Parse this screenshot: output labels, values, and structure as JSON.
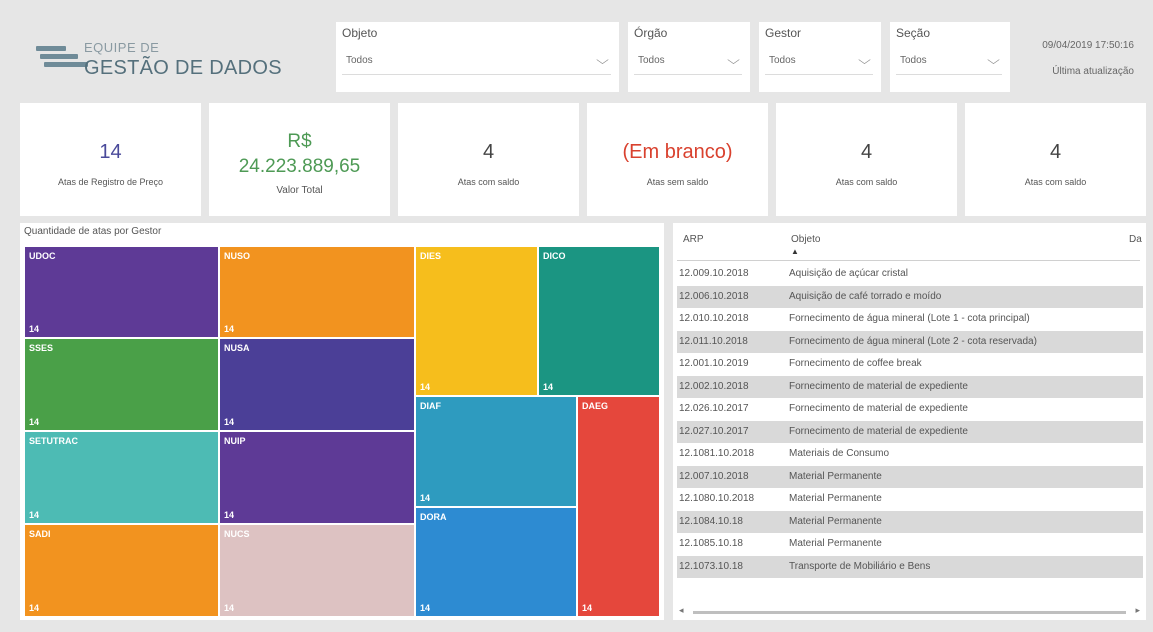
{
  "logo": {
    "small": "EQUIPE DE",
    "big": "GESTÃO DE DADOS"
  },
  "slicers": [
    {
      "title": "Objeto",
      "value": "Todos"
    },
    {
      "title": "Órgão",
      "value": "Todos"
    },
    {
      "title": "Gestor",
      "value": "Todos"
    },
    {
      "title": "Seção",
      "value": "Todos"
    }
  ],
  "status": {
    "datetime": "09/04/2019 17:50:16",
    "label": "Última atualização"
  },
  "kpis": {
    "atas": {
      "value": "14",
      "label": "Atas de Registro de Preço"
    },
    "total": {
      "currency": "R$",
      "value": "24.223.889,65",
      "label": "Valor Total"
    },
    "com_saldo_1": {
      "value": "4",
      "label": "Atas com saldo"
    },
    "sem_saldo": {
      "value": "(Em branco)",
      "label": "Atas sem saldo"
    },
    "com_saldo_2": {
      "value": "4",
      "label": "Atas com saldo"
    },
    "com_saldo_3": {
      "value": "4",
      "label": "Atas com saldo"
    }
  },
  "treemap": {
    "title": "Quantidade de atas por Gestor",
    "tiles": [
      {
        "name": "UDOC",
        "count": "14",
        "color": "#5e3a96"
      },
      {
        "name": "NUSO",
        "count": "14",
        "color": "#f2931f"
      },
      {
        "name": "SSES",
        "count": "14",
        "color": "#4aa048"
      },
      {
        "name": "NUSA",
        "count": "14",
        "color": "#4b3f97"
      },
      {
        "name": "SETUTRAC",
        "count": "14",
        "color": "#4dbbb4"
      },
      {
        "name": "NUIP",
        "count": "14",
        "color": "#5e3a96"
      },
      {
        "name": "SADI",
        "count": "14",
        "color": "#f2931f"
      },
      {
        "name": "NUCS",
        "count": "14",
        "color": "#ddc2c2"
      },
      {
        "name": "DIES",
        "count": "14",
        "color": "#f6be1c"
      },
      {
        "name": "DICO",
        "count": "14",
        "color": "#1b9582"
      },
      {
        "name": "DIAF",
        "count": "14",
        "color": "#2e9bbf"
      },
      {
        "name": "DAEG",
        "count": "14",
        "color": "#e5473c"
      },
      {
        "name": "DORA",
        "count": "14",
        "color": "#2d8bd2"
      }
    ]
  },
  "table": {
    "headers": {
      "arp": "ARP",
      "objeto": "Objeto",
      "extra": "Da"
    },
    "rows": [
      {
        "arp": "12.009.10.2018",
        "objeto": "Aquisição de açúcar cristal"
      },
      {
        "arp": "12.006.10.2018",
        "objeto": "Aquisição de café torrado e moído"
      },
      {
        "arp": "12.010.10.2018",
        "objeto": "Fornecimento de água mineral (Lote 1 - cota principal)"
      },
      {
        "arp": "12.011.10.2018",
        "objeto": "Fornecimento de água mineral (Lote 2 - cota reservada)"
      },
      {
        "arp": "12.001.10.2019",
        "objeto": "Fornecimento de coffee break"
      },
      {
        "arp": "12.002.10.2018",
        "objeto": "Fornecimento de material de expediente"
      },
      {
        "arp": "12.026.10.2017",
        "objeto": "Fornecimento de material de expediente"
      },
      {
        "arp": "12.027.10.2017",
        "objeto": "Fornecimento de material de expediente"
      },
      {
        "arp": "12.1081.10.2018",
        "objeto": "Materiais de Consumo"
      },
      {
        "arp": "12.007.10.2018",
        "objeto": "Material Permanente"
      },
      {
        "arp": "12.1080.10.2018",
        "objeto": "Material Permanente"
      },
      {
        "arp": "12.1084.10.18",
        "objeto": "Material Permanente"
      },
      {
        "arp": "12.1085.10.18",
        "objeto": "Material Permanente"
      },
      {
        "arp": "12.1073.10.18",
        "objeto": "Transporte de Mobiliário e Bens"
      }
    ]
  }
}
